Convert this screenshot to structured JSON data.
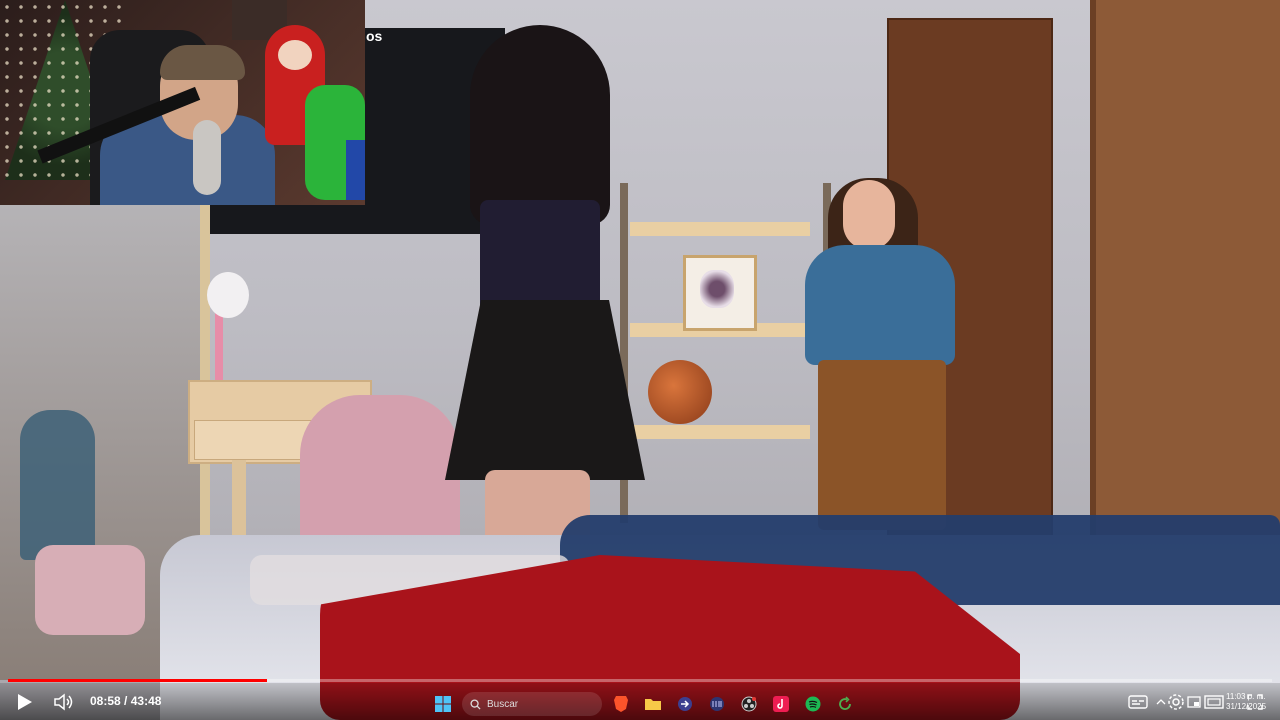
{
  "overlay": {
    "caption_fragment": "os"
  },
  "player": {
    "current_time": "08:58",
    "separator": " / ",
    "duration": "43:48",
    "progress_fraction": 0.205,
    "accent_color": "#ff0000",
    "icons": {
      "play": "play-icon",
      "volume": "volume-icon",
      "subtitles": "subtitles-icon",
      "settings": "gear-icon",
      "miniplayer": "miniplayer-icon",
      "theater": "theater-mode-icon",
      "fullscreen": "fullscreen-icon"
    }
  },
  "taskbar": {
    "search_placeholder": "Buscar",
    "apps": [
      "windows-start-icon",
      "brave-browser-icon",
      "file-explorer-icon",
      "arrow-app-icon",
      "terminal-app-icon",
      "obs-app-icon",
      "tiktok-app-icon",
      "spotify-app-icon",
      "refresh-app-icon"
    ],
    "clock": {
      "time": "11:03 p. m.",
      "date": "31/12/2025"
    }
  }
}
